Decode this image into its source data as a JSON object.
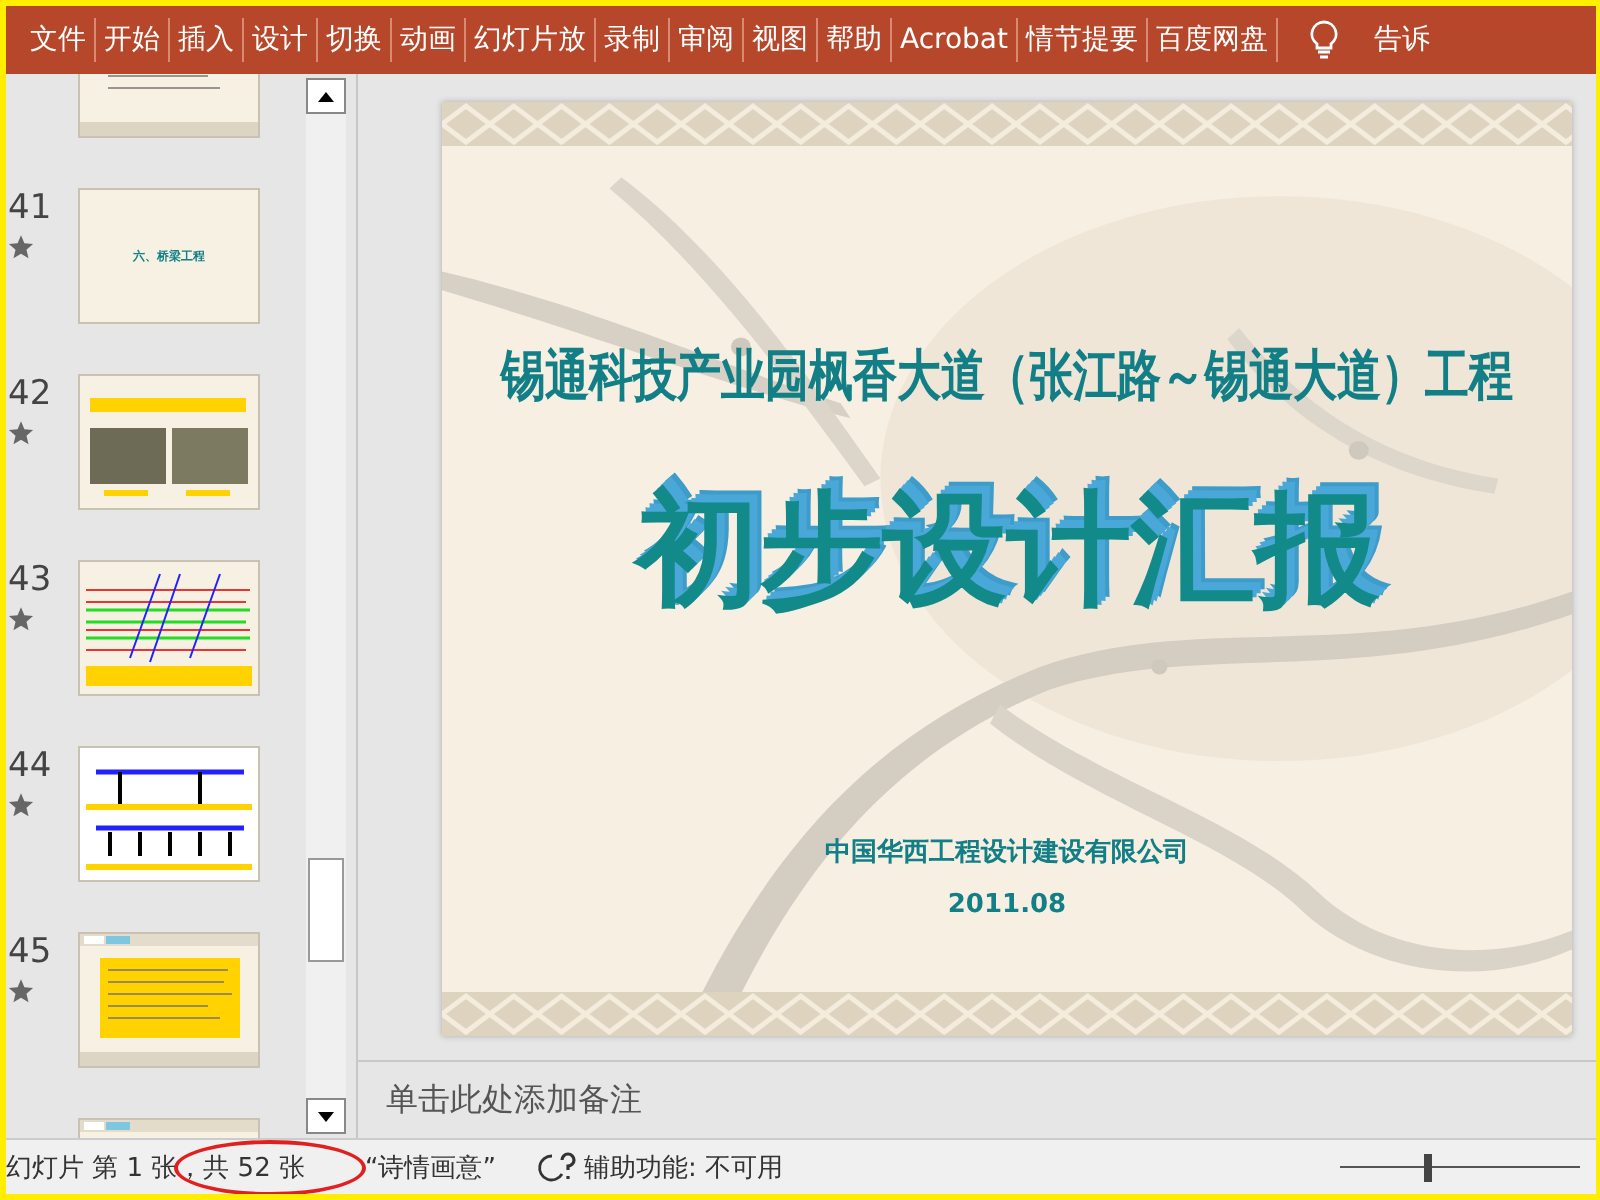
{
  "ribbon": {
    "tabs": [
      {
        "label": "文件"
      },
      {
        "label": "开始"
      },
      {
        "label": "插入"
      },
      {
        "label": "设计"
      },
      {
        "label": "切换"
      },
      {
        "label": "动画"
      },
      {
        "label": "幻灯片放"
      },
      {
        "label": "录制"
      },
      {
        "label": "审阅"
      },
      {
        "label": "视图"
      },
      {
        "label": "帮助"
      },
      {
        "label": "Acrobat"
      },
      {
        "label": "情节提要"
      },
      {
        "label": "百度网盘"
      }
    ],
    "tell_me": "告诉"
  },
  "thumbnails": [
    {
      "kind": "text"
    },
    {
      "number": "41",
      "kind": "title",
      "title": "六、桥梁工程"
    },
    {
      "number": "42",
      "kind": "photos"
    },
    {
      "number": "43",
      "kind": "map"
    },
    {
      "number": "44",
      "kind": "drawing"
    },
    {
      "number": "45",
      "kind": "text"
    },
    {
      "kind": "text"
    }
  ],
  "slide": {
    "subtitle": "锡通科技产业园枫香大道（张江路～锡通大道）工程",
    "title": "初步设计汇报",
    "company": "中国华西工程设计建设有限公司",
    "date": "2011.08"
  },
  "notes": {
    "placeholder": "单击此处添加备注"
  },
  "status_bar": {
    "slide_count": "幻灯片 第 1 张，共 52 张",
    "theme": "“诗情画意”",
    "accessibility": "辅助功能: 不可用",
    "zoom_slider": {
      "level": 0.35
    }
  }
}
